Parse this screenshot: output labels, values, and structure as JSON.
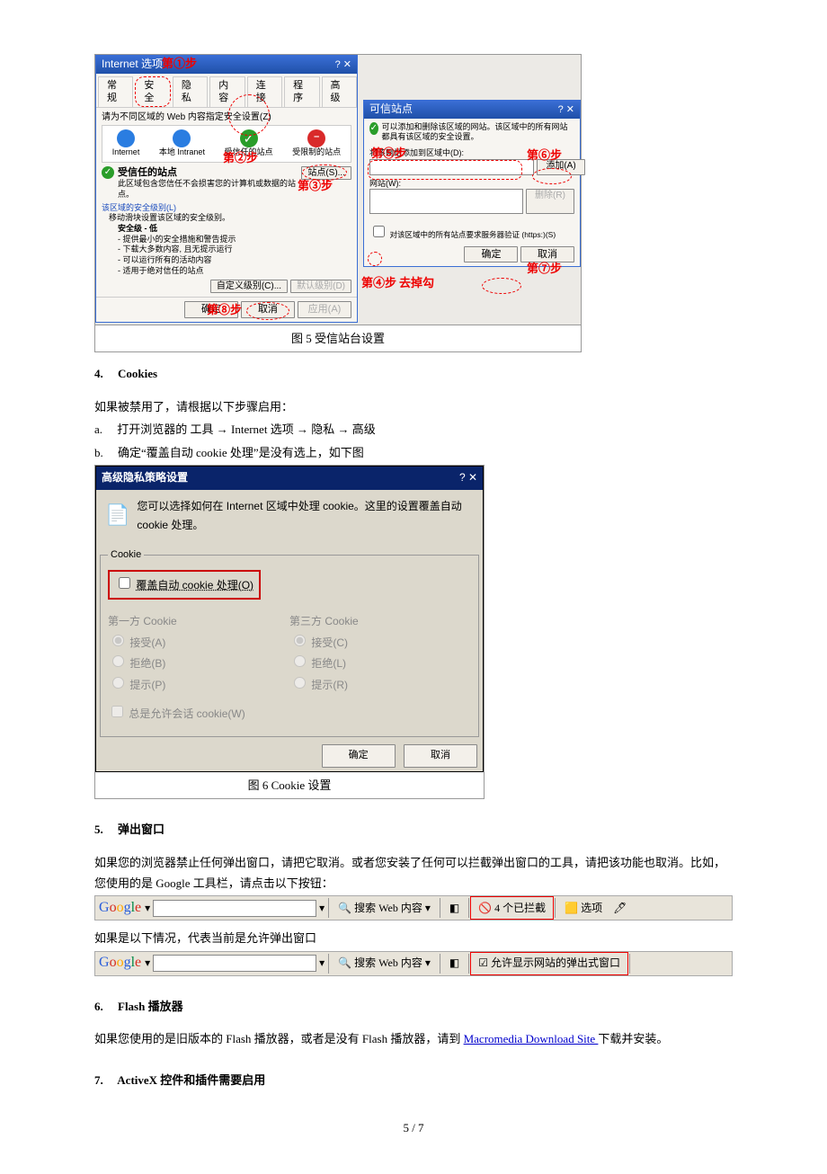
{
  "fig5": {
    "window1": {
      "title": "Internet 选项",
      "tabs": [
        "常规",
        "安全",
        "隐私",
        "内容",
        "连接",
        "程序",
        "高级"
      ],
      "instruction": "请为不同区域的 Web 内容指定安全设置(Z)",
      "zones": {
        "internet": "Internet",
        "intranet": "本地 Intranet",
        "trusted": "受信任的站点",
        "restricted": "受限制的站点"
      },
      "trusted_desc_title": "受信任的站点",
      "trusted_desc_body": "此区域包含您信任不会损害您的计算机或数据的站点。",
      "sites_btn": "站点(S)...",
      "level_link": "该区域的安全级别(L)",
      "slider_hint": "移动滑块设置该区域的安全级别。",
      "level_title": "安全级 - 低",
      "level_lines": [
        "- 提供最小的安全措施和警告提示",
        "- 下载大多数内容, 且无提示运行",
        "- 可以运行所有的活动内容",
        "- 适用于绝对信任的站点"
      ],
      "custom_btn": "自定义级别(C)...",
      "default_btn": "默认级别(D)",
      "ok": "确定",
      "cancel": "取消",
      "apply": "应用(A)"
    },
    "window2": {
      "title": "可信站点",
      "desc": "可以添加和删除该区域的网站。该区域中的所有网站都具有该区域的安全设置。",
      "add_label": "将该网站添加到区域中(D):",
      "add_btn": "添加(A)",
      "list_label": "网站(W):",
      "remove_btn": "删除(R)",
      "https_check": "对该区域中的所有站点要求服务器验证 (https:)(S)",
      "ok": "确定",
      "cancel": "取消"
    },
    "steps": {
      "s1": "第①步",
      "s2": "第②步",
      "s3": "第③步",
      "s4a": "第④步",
      "s4b": "去掉勾",
      "s5": "第⑤步",
      "s6": "第⑥步",
      "s7": "第⑦步",
      "s8": "第⑧步"
    },
    "caption": "图 5 受信站台设置"
  },
  "sec4": {
    "title": "4.　 Cookies",
    "line1": "如果被禁用了，请根据以下步骤启用：",
    "line2": "a.　 打开浏览器的 工具 → Internet 选项 → 隐私 → 高级",
    "line3": "b.　 确定“覆盖自动 cookie 处理”是没有选上，如下图"
  },
  "privacy": {
    "title": "高级隐私策略设置",
    "desc": "您可以选择如何在 Internet 区域中处理 cookie。这里的设置覆盖自动 cookie 处理。",
    "group": "Cookie",
    "override": "覆盖自动 cookie 处理(O)",
    "col1": "第一方 Cookie",
    "col2": "第三方 Cookie",
    "accept1": "接受(A)",
    "reject1": "拒绝(B)",
    "prompt1": "提示(P)",
    "accept2": "接受(C)",
    "reject2": "拒绝(L)",
    "prompt2": "提示(R)",
    "session": "总是允许会话 cookie(W)",
    "ok": "确定",
    "cancel": "取消",
    "caption": "图 6 Cookie 设置"
  },
  "sec5": {
    "title": "5.　 弹出窗口",
    "p1": "如果您的浏览器禁止任何弹出窗口，请把它取消。或者您安装了任何可以拦截弹出窗口的工具，请把该功能也取消。比如，您使用的是 Google 工具栏，请点击以下按钮：",
    "p2": "如果是以下情况，代表当前是允许弹出窗口",
    "toolbar": {
      "brand": "Google",
      "search_btn": "搜索 Web 内容",
      "blocked": "4 个已拦截",
      "options": "选项",
      "allow": "允许显示网站的弹出式窗口"
    }
  },
  "sec6": {
    "title": "6.　 Flash 播放器",
    "p": "如果您使用的是旧版本的 Flash 播放器，或者是没有 Flash 播放器，请到 ",
    "link": "Macromedia Download Site ",
    "p2": "下载并安装。"
  },
  "sec7": {
    "title": "7.　 ActiveX 控件和插件需要启用"
  },
  "pagenum": "5 / 7"
}
